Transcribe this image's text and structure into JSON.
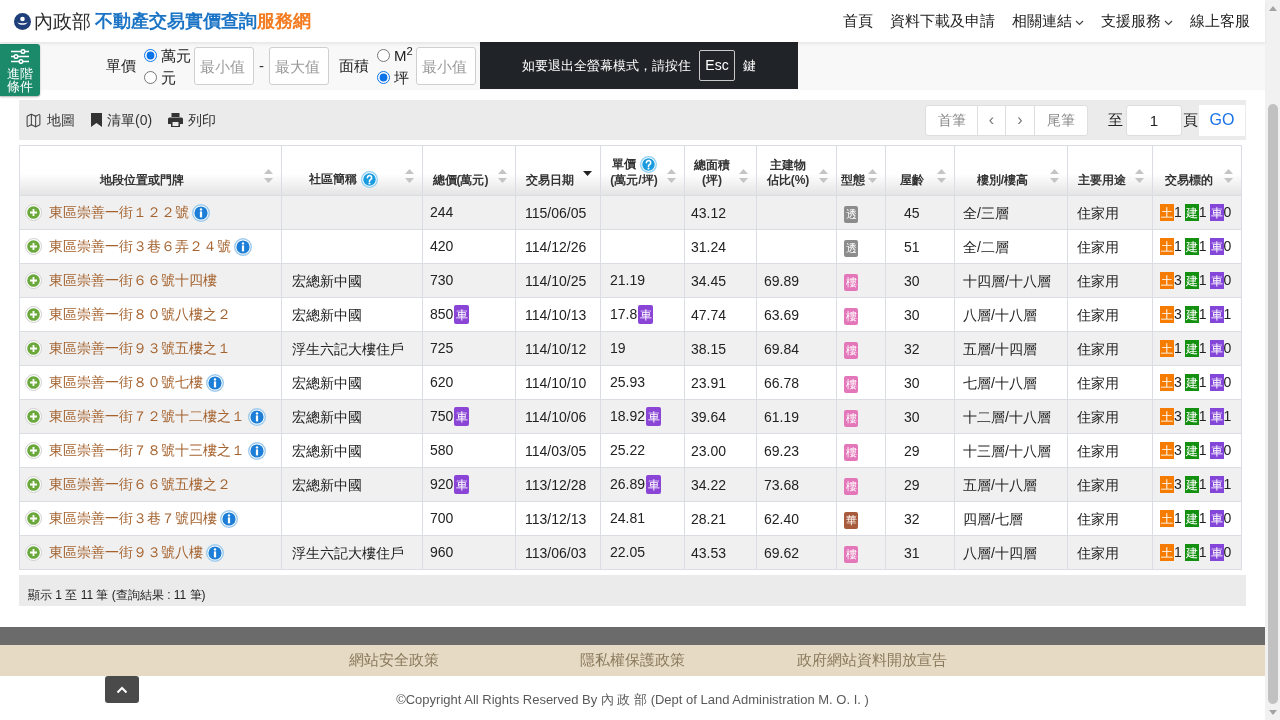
{
  "header": {
    "logo": {
      "ministry": "內政部",
      "title": "不動產交易實價查詢",
      "suffix": "服務網"
    },
    "nav": [
      {
        "label": "首頁",
        "dropdown": false
      },
      {
        "label": "資料下載及申請",
        "dropdown": false
      },
      {
        "label": "相關連結",
        "dropdown": true
      },
      {
        "label": "支援服務",
        "dropdown": true
      },
      {
        "label": "線上客服",
        "dropdown": false
      }
    ]
  },
  "filters": {
    "advanced_button": "進階條件",
    "groups": [
      {
        "label": "單價",
        "options": [
          {
            "label": "萬元",
            "selected": true
          },
          {
            "label": "元",
            "selected": false
          }
        ],
        "inputs": [
          {
            "placeholder": "最小值"
          },
          {
            "placeholder": "最大值"
          }
        ],
        "separator": "-"
      },
      {
        "label": "面積",
        "options": [
          {
            "label": "M$^{2}$",
            "selected": false
          },
          {
            "label": "坪",
            "selected": true
          }
        ],
        "inputs": [
          {
            "placeholder": "最小值"
          }
        ]
      }
    ]
  },
  "fullscreen_notice": {
    "message": "如要退出全螢幕模式，請按住",
    "key": "Esc",
    "suffix": "鍵"
  },
  "toolbar": {
    "views": [
      {
        "kind": "map",
        "label": "地圖"
      },
      {
        "kind": "list",
        "label": "清單(0)"
      },
      {
        "kind": "print",
        "label": "列印"
      }
    ],
    "pagination": {
      "first": "首筆",
      "prev": "‹",
      "next": "›",
      "last": "尾筆",
      "goto_prefix": "至",
      "page": "1",
      "goto_suffix": "頁",
      "go": "GO"
    }
  },
  "table": {
    "columns": [
      {
        "lines": [
          "地段位置或門牌"
        ],
        "help": false,
        "sorted": false
      },
      {
        "lines": [
          "社區簡稱"
        ],
        "help": true,
        "sorted": false
      },
      {
        "lines": [
          "總價(萬元)"
        ],
        "help": false,
        "sorted": false
      },
      {
        "lines": [
          "交易日期"
        ],
        "help": false,
        "sorted": true
      },
      {
        "lines": [
          "單價",
          "(萬元/坪)"
        ],
        "help": true,
        "sorted": false
      },
      {
        "lines": [
          "總面積",
          "(坪)"
        ],
        "help": false,
        "sorted": false
      },
      {
        "lines": [
          "主建物",
          "佔比(%)"
        ],
        "help": false,
        "sorted": false
      },
      {
        "lines": [
          "型態"
        ],
        "help": false,
        "sorted": false
      },
      {
        "lines": [
          "屋齡"
        ],
        "help": false,
        "sorted": false
      },
      {
        "lines": [
          "樓別/樓高"
        ],
        "help": false,
        "sorted": false
      },
      {
        "lines": [
          "主要用途"
        ],
        "help": false,
        "sorted": false
      },
      {
        "lines": [
          "交易標的"
        ],
        "help": false,
        "sorted": false
      }
    ],
    "rows": [
      {
        "address": "東區崇善一街１２２號",
        "info": true,
        "total_price": "244",
        "date": "115/06/05",
        "area": "43.12",
        "type": {
          "label": "透",
          "color": "#8c8c8c"
        },
        "age": "45",
        "floor": "全/三層",
        "use": "住家用",
        "items": [
          {
            "label": "土",
            "count": "1",
            "color": "#f57c00"
          },
          {
            "label": "建",
            "count": "1",
            "color": "#13900f"
          },
          {
            "label": "車",
            "count": "0",
            "color": "#8446d8"
          }
        ]
      },
      {
        "address": "東區崇善一街３巷６弄２４號",
        "info": true,
        "total_price": "420",
        "date": "114/12/26",
        "area": "31.24",
        "type": {
          "label": "透",
          "color": "#8c8c8c"
        },
        "age": "51",
        "floor": "全/二層",
        "use": "住家用",
        "items": [
          {
            "label": "土",
            "count": "1",
            "color": "#f57c00"
          },
          {
            "label": "建",
            "count": "1",
            "color": "#13900f"
          },
          {
            "label": "車",
            "count": "0",
            "color": "#8446d8"
          }
        ]
      },
      {
        "address": "東區崇善一街６６號十四樓",
        "info": false,
        "community": "宏總新中國",
        "total_price": "730",
        "date": "114/10/25",
        "unit_price": "21.19",
        "area": "34.45",
        "main_ratio": "69.89",
        "type": {
          "label": "樓",
          "color": "#e377b9"
        },
        "age": "30",
        "floor": "十四層/十八層",
        "use": "住家用",
        "items": [
          {
            "label": "土",
            "count": "3",
            "color": "#f57c00"
          },
          {
            "label": "建",
            "count": "1",
            "color": "#13900f"
          },
          {
            "label": "車",
            "count": "0",
            "color": "#8446d8"
          }
        ]
      },
      {
        "address": "東區崇善一街８０號八樓之２",
        "info": false,
        "community": "宏總新中國",
        "total_price": "850",
        "total_price_tag": "車",
        "date": "114/10/13",
        "unit_price": "17.8",
        "unit_price_tag": "車",
        "area": "47.74",
        "main_ratio": "63.69",
        "type": {
          "label": "樓",
          "color": "#e377b9"
        },
        "age": "30",
        "floor": "八層/十八層",
        "use": "住家用",
        "items": [
          {
            "label": "土",
            "count": "3",
            "color": "#f57c00"
          },
          {
            "label": "建",
            "count": "1",
            "color": "#13900f"
          },
          {
            "label": "車",
            "count": "1",
            "color": "#8446d8"
          }
        ]
      },
      {
        "address": "東區崇善一街９３號五樓之１",
        "info": false,
        "community": "浮生六記大樓住戶",
        "total_price": "725",
        "date": "114/10/12",
        "unit_price": "19",
        "area": "38.15",
        "main_ratio": "69.84",
        "type": {
          "label": "樓",
          "color": "#e377b9"
        },
        "age": "32",
        "floor": "五層/十四層",
        "use": "住家用",
        "items": [
          {
            "label": "土",
            "count": "1",
            "color": "#f57c00"
          },
          {
            "label": "建",
            "count": "1",
            "color": "#13900f"
          },
          {
            "label": "車",
            "count": "0",
            "color": "#8446d8"
          }
        ]
      },
      {
        "address": "東區崇善一街８０號七樓",
        "info": true,
        "community": "宏總新中國",
        "total_price": "620",
        "date": "114/10/10",
        "unit_price": "25.93",
        "area": "23.91",
        "main_ratio": "66.78",
        "type": {
          "label": "樓",
          "color": "#e377b9"
        },
        "age": "30",
        "floor": "七層/十八層",
        "use": "住家用",
        "items": [
          {
            "label": "土",
            "count": "3",
            "color": "#f57c00"
          },
          {
            "label": "建",
            "count": "1",
            "color": "#13900f"
          },
          {
            "label": "車",
            "count": "0",
            "color": "#8446d8"
          }
        ]
      },
      {
        "address": "東區崇善一街７２號十二樓之１",
        "info": true,
        "community": "宏總新中國",
        "total_price": "750",
        "total_price_tag": "車",
        "date": "114/10/06",
        "unit_price": "18.92",
        "unit_price_tag": "車",
        "area": "39.64",
        "main_ratio": "61.19",
        "type": {
          "label": "樓",
          "color": "#e377b9"
        },
        "age": "30",
        "floor": "十二層/十八層",
        "use": "住家用",
        "items": [
          {
            "label": "土",
            "count": "3",
            "color": "#f57c00"
          },
          {
            "label": "建",
            "count": "1",
            "color": "#13900f"
          },
          {
            "label": "車",
            "count": "1",
            "color": "#8446d8"
          }
        ]
      },
      {
        "address": "東區崇善一街７８號十三樓之１",
        "info": true,
        "community": "宏總新中國",
        "total_price": "580",
        "date": "114/03/05",
        "unit_price": "25.22",
        "area": "23.00",
        "main_ratio": "69.23",
        "type": {
          "label": "樓",
          "color": "#e377b9"
        },
        "age": "29",
        "floor": "十三層/十八層",
        "use": "住家用",
        "items": [
          {
            "label": "土",
            "count": "3",
            "color": "#f57c00"
          },
          {
            "label": "建",
            "count": "1",
            "color": "#13900f"
          },
          {
            "label": "車",
            "count": "0",
            "color": "#8446d8"
          }
        ]
      },
      {
        "address": "東區崇善一街６６號五樓之２",
        "info": false,
        "community": "宏總新中國",
        "total_price": "920",
        "total_price_tag": "車",
        "date": "113/12/28",
        "unit_price": "26.89",
        "unit_price_tag": "車",
        "area": "34.22",
        "main_ratio": "73.68",
        "type": {
          "label": "樓",
          "color": "#e377b9"
        },
        "age": "29",
        "floor": "五層/十八層",
        "use": "住家用",
        "items": [
          {
            "label": "土",
            "count": "3",
            "color": "#f57c00"
          },
          {
            "label": "建",
            "count": "1",
            "color": "#13900f"
          },
          {
            "label": "車",
            "count": "1",
            "color": "#8446d8"
          }
        ]
      },
      {
        "address": "東區崇善一街３巷７號四樓",
        "info": true,
        "total_price": "700",
        "date": "113/12/13",
        "unit_price": "24.81",
        "area": "28.21",
        "main_ratio": "62.40",
        "type": {
          "label": "華",
          "color": "#a85b3c"
        },
        "age": "32",
        "floor": "四層/七層",
        "use": "住家用",
        "items": [
          {
            "label": "土",
            "count": "1",
            "color": "#f57c00"
          },
          {
            "label": "建",
            "count": "1",
            "color": "#13900f"
          },
          {
            "label": "車",
            "count": "0",
            "color": "#8446d8"
          }
        ]
      },
      {
        "address": "東區崇善一街９３號八樓",
        "info": true,
        "community": "浮生六記大樓住戶",
        "total_price": "960",
        "date": "113/06/03",
        "unit_price": "22.05",
        "area": "43.53",
        "main_ratio": "69.62",
        "type": {
          "label": "樓",
          "color": "#e377b9"
        },
        "age": "31",
        "floor": "八層/十四層",
        "use": "住家用",
        "items": [
          {
            "label": "土",
            "count": "1",
            "color": "#f57c00"
          },
          {
            "label": "建",
            "count": "1",
            "color": "#13900f"
          },
          {
            "label": "車",
            "count": "0",
            "color": "#8446d8"
          }
        ]
      }
    ]
  },
  "summary": "顯示 1 至 11 筆 (查詢結果 : 11 筆)",
  "footer": {
    "links": [
      "網站安全政策",
      "隱私權保護政策",
      "政府網站資料開放宣告"
    ],
    "copyright": "©Copyright All Rights Reserved By 內 政 部 (Dept of Land Administration M. O. I. )"
  }
}
